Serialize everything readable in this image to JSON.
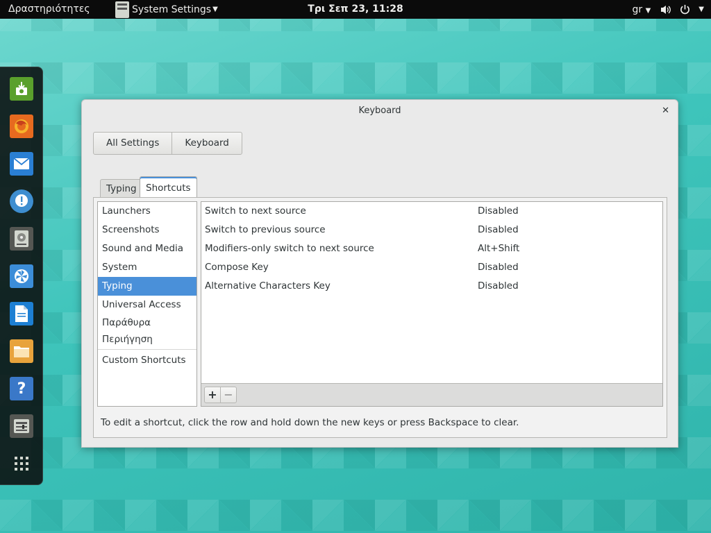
{
  "topbar": {
    "activities": "Δραστηριότητες",
    "app_name": "System Settings",
    "clock": "Τρι Σεπ 23, 11:28",
    "keyboard_layout": "gr"
  },
  "dock": {
    "items": [
      {
        "icon": "software-install-icon",
        "color": "#5aa02c"
      },
      {
        "icon": "firefox-icon",
        "color": "#e66a1f"
      },
      {
        "icon": "mail-icon",
        "color": "#2a7fd4"
      },
      {
        "icon": "empathy-chat-icon",
        "color": "#3e8ed0"
      },
      {
        "icon": "disks-icon",
        "color": "#555753"
      },
      {
        "icon": "shotwell-icon",
        "color": "#3c8dd8"
      },
      {
        "icon": "libreoffice-writer-icon",
        "color": "#1d7fd3"
      },
      {
        "icon": "files-folder-icon",
        "color": "#e8a33c"
      },
      {
        "icon": "help-icon",
        "color": "#3a78c8"
      },
      {
        "icon": "system-settings-icon",
        "color": "#555753"
      },
      {
        "icon": "show-applications-icon",
        "color": ""
      }
    ]
  },
  "window": {
    "title": "Keyboard",
    "breadcrumbs": [
      "All Settings",
      "Keyboard"
    ],
    "tabs": [
      "Typing",
      "Shortcuts"
    ],
    "active_tab": "Shortcuts",
    "categories": [
      "Launchers",
      "Screenshots",
      "Sound and Media",
      "System",
      "Typing",
      "Universal Access",
      "Παράθυρα",
      "Περιήγηση",
      "Custom Shortcuts"
    ],
    "selected_category": "Typing",
    "shortcuts": [
      {
        "name": "Switch to next source",
        "accel": "Disabled"
      },
      {
        "name": "Switch to previous source",
        "accel": "Disabled"
      },
      {
        "name": "Modifiers-only switch to next source",
        "accel": "Alt+Shift"
      },
      {
        "name": "Compose Key",
        "accel": "Disabled"
      },
      {
        "name": "Alternative Characters Key",
        "accel": "Disabled"
      }
    ],
    "add_label": "+",
    "remove_label": "−",
    "hint": "To edit a shortcut, click the row and hold down the new keys or press Backspace to clear."
  },
  "colors": {
    "accent": "#4a90d9",
    "topbar": "#0b0b0b",
    "desktop": "#3ec4bb"
  }
}
